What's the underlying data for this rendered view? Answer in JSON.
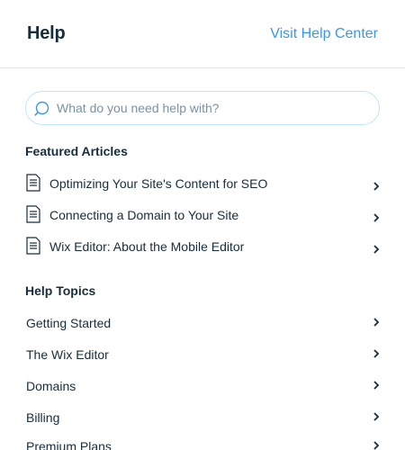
{
  "header": {
    "title": "Help",
    "link_label": "Visit Help Center"
  },
  "search": {
    "placeholder": "What do you need help with?",
    "value": "",
    "icon": "search-icon"
  },
  "featured": {
    "title": "Featured Articles",
    "icon": "document-icon",
    "items": [
      {
        "label": "Optimizing Your Site's Content for SEO"
      },
      {
        "label": "Connecting a Domain to Your Site"
      },
      {
        "label": "Wix Editor: About the Mobile Editor"
      }
    ]
  },
  "topics": {
    "title": "Help Topics",
    "items": [
      {
        "label": "Getting Started"
      },
      {
        "label": "The Wix Editor"
      },
      {
        "label": "Domains"
      },
      {
        "label": "Billing"
      },
      {
        "label": "Premium Plans"
      }
    ]
  },
  "colors": {
    "accent": "#3899ec",
    "text": "#162d3d",
    "divider": "#dfe5eb",
    "search_border": "#c1e4fe"
  }
}
